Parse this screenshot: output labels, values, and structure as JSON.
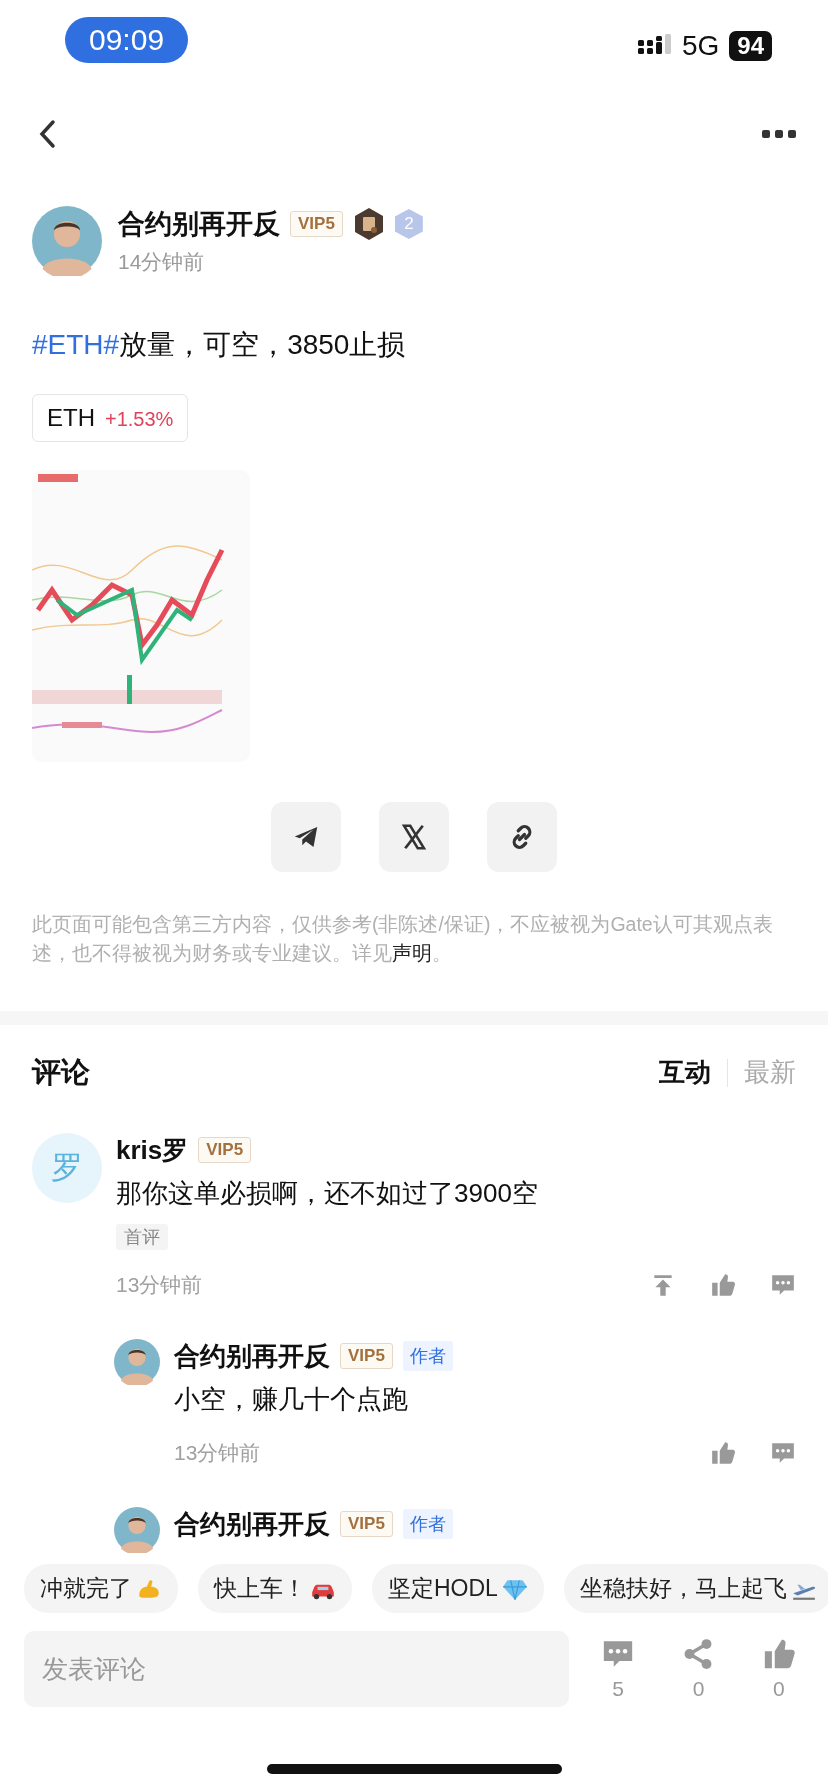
{
  "status_bar": {
    "time": "09:09",
    "network": "5G",
    "battery": "94"
  },
  "post": {
    "author": {
      "name": "合约别再开反",
      "vip": "VIP5",
      "level": "2"
    },
    "time": "14分钟前",
    "hashtag": "#ETH#",
    "text": "放量，可空，3850止损",
    "ticker": {
      "symbol": "ETH",
      "change": "+1.53%"
    },
    "share_buttons": [
      {
        "kind": "telegram"
      },
      {
        "kind": "x"
      },
      {
        "kind": "link"
      }
    ],
    "disclaimer": {
      "text": "此页面可能包含第三方内容，仅供参考(非陈述/保证)，不应被视为Gate认可其观点表述，也不得被视为财务或专业建议。详见",
      "link": "声明",
      "end": "。"
    }
  },
  "comments": {
    "title": "评论",
    "sort_tabs": [
      {
        "label": "互动",
        "selected": true
      },
      {
        "label": "最新",
        "selected": false
      }
    ],
    "items": [
      {
        "author": "kris罗",
        "avatar_text": "罗",
        "vip": "VIP5",
        "text": "那你这单必损啊，还不如过了3900空",
        "tag": "首评",
        "time": "13分钟前",
        "actions": [
          {
            "kind": "pin"
          },
          {
            "kind": "like"
          },
          {
            "kind": "reply"
          }
        ],
        "replies": [
          {
            "author": "合约别再开反",
            "vip": "VIP5",
            "role": "作者",
            "text": "小空，赚几十个点跑",
            "time": "13分钟前",
            "actions": [
              {
                "kind": "like"
              },
              {
                "kind": "reply"
              }
            ]
          },
          {
            "author": "合约别再开反",
            "vip": "VIP5",
            "role": "作者"
          }
        ]
      }
    ]
  },
  "quick_replies": [
    {
      "text": "冲就完了"
    },
    {
      "text": "快上车！"
    },
    {
      "text": "坚定HODL"
    },
    {
      "text": "坐稳扶好，马上起飞"
    }
  ],
  "composer": {
    "placeholder": "发表评论"
  },
  "stats": [
    {
      "kind": "comments",
      "count": "5"
    },
    {
      "kind": "share",
      "count": "0"
    },
    {
      "kind": "like",
      "count": "0"
    }
  ]
}
